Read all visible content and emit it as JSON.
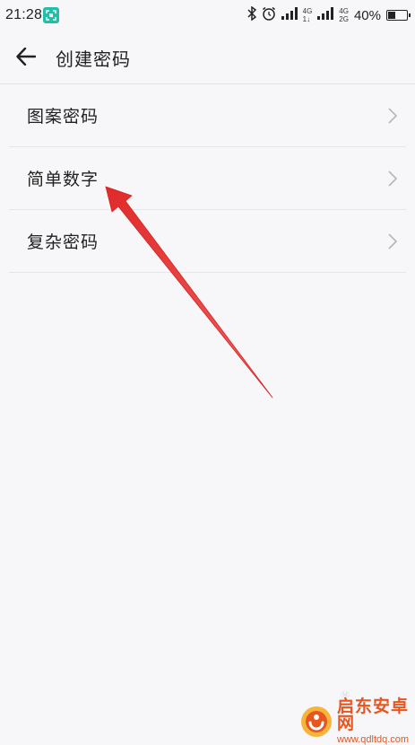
{
  "status_bar": {
    "time": "21:28",
    "network_top": "4G",
    "network_bottom": "1↓",
    "network2_top": "4G",
    "network2_bottom": "2G",
    "battery_percent": "40%",
    "battery_level": 0.4,
    "icons": [
      "scan-icon",
      "bluetooth-icon",
      "alarm-icon",
      "signal-icon",
      "signal-icon",
      "battery-icon"
    ]
  },
  "header": {
    "title": "创建密码",
    "back_icon": "back-arrow-icon"
  },
  "options": [
    {
      "label": "图案密码"
    },
    {
      "label": "简单数字"
    },
    {
      "label": "复杂密码"
    }
  ],
  "watermark": {
    "title": "启东安卓网",
    "url": "www.qdltdq.com"
  },
  "colors": {
    "background": "#f7f7f9",
    "divider": "#e6e6ea",
    "annotation_arrow": "#e53a3a",
    "watermark": "#e8551e",
    "scan_badge": "#22bfa8"
  }
}
